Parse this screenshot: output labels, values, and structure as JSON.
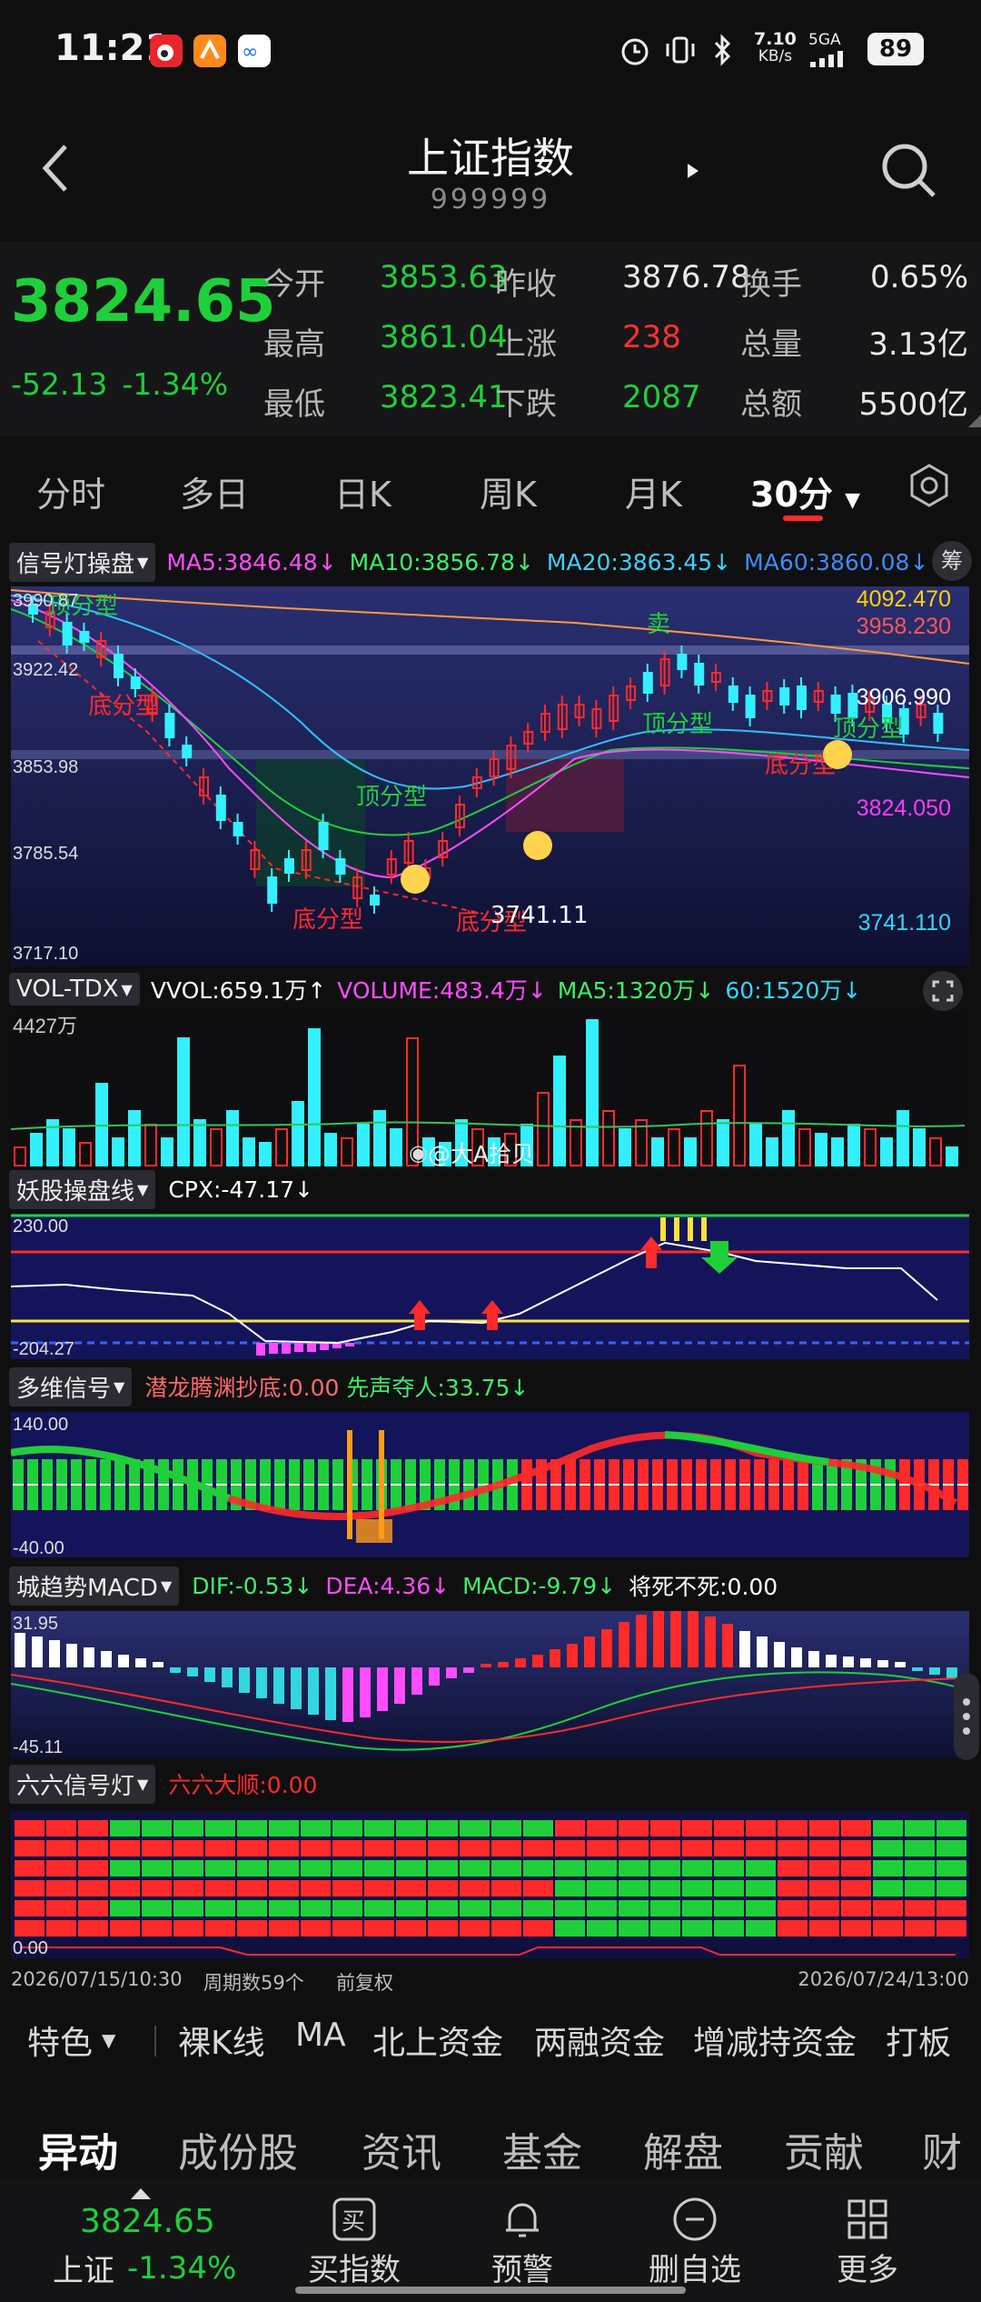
{
  "status": {
    "time": "11:21",
    "net_speed_top": "7.10",
    "net_speed_bottom": "KB/s",
    "signal": "5GA",
    "battery": "89"
  },
  "nav": {
    "title": "上证指数",
    "code": "999999"
  },
  "quote": {
    "price": "3824.65",
    "change": "-52.13",
    "change_pct": "-1.34%",
    "cells": [
      {
        "label": "今开",
        "value": "3853.63",
        "color": "green"
      },
      {
        "label": "昨收",
        "value": "3876.78",
        "color": "white"
      },
      {
        "label": "换手",
        "value": "0.65%",
        "color": "white"
      },
      {
        "label": "最高",
        "value": "3861.04",
        "color": "green"
      },
      {
        "label": "上涨",
        "value": "238",
        "color": "red"
      },
      {
        "label": "总量",
        "value": "3.13亿",
        "color": "white"
      },
      {
        "label": "最低",
        "value": "3823.41",
        "color": "green"
      },
      {
        "label": "下跌",
        "value": "2087",
        "color": "green"
      },
      {
        "label": "总额",
        "value": "5500亿",
        "color": "white"
      }
    ]
  },
  "tabs": [
    "分时",
    "多日",
    "日K",
    "周K",
    "月K",
    "30分"
  ],
  "main_chart": {
    "indicator": "信号灯操盘",
    "ma": [
      {
        "text": "MA5:3846.48↓",
        "color": "#ff4dff"
      },
      {
        "text": "MA10:3856.78↓",
        "color": "#3df06b"
      },
      {
        "text": "MA20:3863.45↓",
        "color": "#3fd0ff"
      },
      {
        "text": "MA60:3860.08↓",
        "color": "#3c8cff"
      }
    ],
    "badge": "筹",
    "left_axis": [
      "3990.87",
      "3922.42",
      "3853.98",
      "3785.54",
      "3717.10"
    ],
    "right_labels": [
      {
        "text": "4092.470",
        "color": "#ffd200"
      },
      {
        "text": "3958.230",
        "color": "#ff5757"
      },
      {
        "text": "3906.990",
        "color": "#ffffff"
      },
      {
        "text": "3824.050",
        "color": "#ff3df5"
      },
      {
        "text": "3741.110",
        "color": "#33d6ff"
      }
    ],
    "annotations": [
      "顶分型",
      "底分型",
      "顶分型",
      "底分型",
      "底分型",
      "顶分型",
      "顶分型",
      "底分型",
      "卖",
      "3741.11"
    ]
  },
  "vol": {
    "indicator": "VOL-TDX",
    "items": [
      {
        "text": "VVOL:659.1万↑",
        "color": "#ffffff"
      },
      {
        "text": "VOLUME:483.4万↓",
        "color": "#ff4dff"
      },
      {
        "text": "MA5:1320万↓",
        "color": "#3df06b"
      },
      {
        "text": "60:1520万↓",
        "color": "#33d6ff"
      }
    ],
    "axis_top": "4427万",
    "watermark": "@大A拾贝"
  },
  "cpx": {
    "indicator": "妖股操盘线",
    "value": "CPX:-47.17↓",
    "axis_top": "230.00",
    "axis_bottom": "-204.27"
  },
  "multi": {
    "indicator": "多维信号",
    "items": [
      {
        "text": "潜龙腾渊抄底:0.00",
        "color": "#ff6a6a"
      },
      {
        "text": "先声夺人:33.75↓",
        "color": "#3df06b"
      }
    ],
    "axis_top": "140.00",
    "axis_bottom": "-40.00"
  },
  "macd": {
    "indicator": "城趋势MACD",
    "items": [
      {
        "text": "DIF:-0.53↓",
        "color": "#3df06b"
      },
      {
        "text": "DEA:4.36↓",
        "color": "#ff4dff"
      },
      {
        "text": "MACD:-9.79↓",
        "color": "#3df06b"
      },
      {
        "text": "将死不死:0.00",
        "color": "#ffffff"
      }
    ],
    "axis_top": "31.95",
    "axis_bottom": "-45.11"
  },
  "six": {
    "indicator": "六六信号灯",
    "value": "六六大顺:0.00",
    "axis_bottom": "0.00"
  },
  "time_axis": {
    "start": "2026/07/15/10:30",
    "periods": "周期数59个",
    "adjust": "前复权",
    "end": "2026/07/24/13:00"
  },
  "funcs": [
    "特色",
    "裸K线",
    "MA",
    "北上资金",
    "两融资金",
    "增减持资金",
    "打板"
  ],
  "subtabs": [
    "异动",
    "成份股",
    "资讯",
    "基金",
    "解盘",
    "贡献",
    "财富"
  ],
  "bottom_nav": {
    "index_price": "3824.65",
    "index_name": "上证",
    "index_pct": "-1.34%",
    "items": [
      {
        "label": "买指数",
        "icon": "buy-icon"
      },
      {
        "label": "预警",
        "icon": "bell-icon"
      },
      {
        "label": "删自选",
        "icon": "remove-icon"
      },
      {
        "label": "更多",
        "icon": "grid-icon"
      }
    ]
  }
}
